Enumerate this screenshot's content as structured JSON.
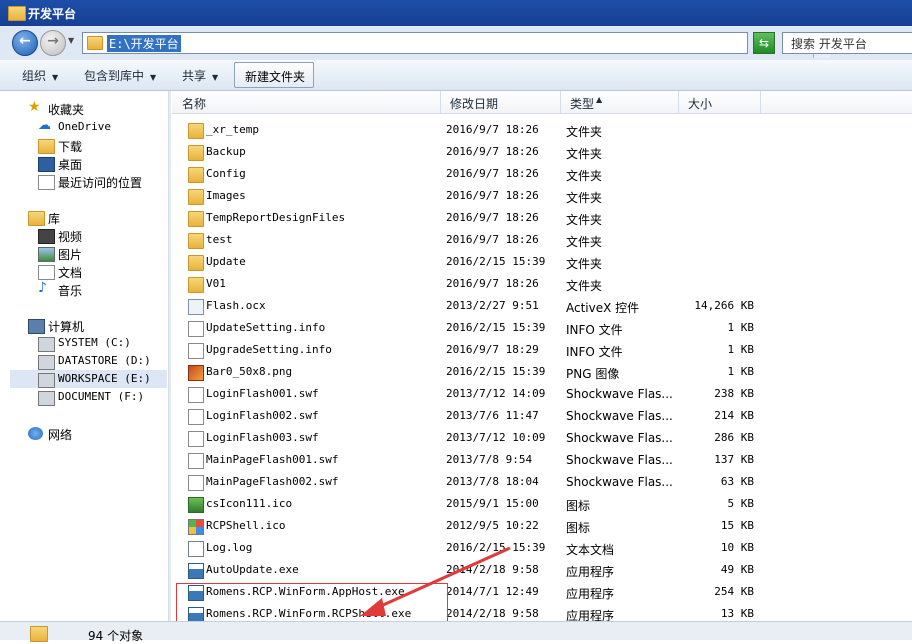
{
  "window": {
    "title": "开发平台"
  },
  "address": {
    "path": "E:\\开发平台",
    "search_placeholder": "搜索 开发平台"
  },
  "toolbar": {
    "organize": "组织",
    "include_in_library": "包含到库中",
    "share": "共享",
    "new_folder": "新建文件夹"
  },
  "nav": {
    "favorites": "收藏夹",
    "onedrive": "OneDrive",
    "downloads": "下载",
    "desktop": "桌面",
    "recent": "最近访问的位置",
    "libraries": "库",
    "videos": "视频",
    "pictures": "图片",
    "documents": "文档",
    "music": "音乐",
    "computer": "计算机",
    "drive_c": "SYSTEM (C:)",
    "drive_d": "DATASTORE (D:)",
    "drive_e": "WORKSPACE (E:)",
    "drive_f": "DOCUMENT (F:)",
    "network": "网络"
  },
  "columns": {
    "name": "名称",
    "modified": "修改日期",
    "type": "类型",
    "size": "大小"
  },
  "files": [
    {
      "name": "_xr_temp",
      "date": "2016/9/7 18:26",
      "type": "文件夹",
      "size": "",
      "icon": "folder-icon"
    },
    {
      "name": "Backup",
      "date": "2016/9/7 18:26",
      "type": "文件夹",
      "size": "",
      "icon": "folder-icon"
    },
    {
      "name": "Config",
      "date": "2016/9/7 18:26",
      "type": "文件夹",
      "size": "",
      "icon": "folder-icon"
    },
    {
      "name": "Images",
      "date": "2016/9/7 18:26",
      "type": "文件夹",
      "size": "",
      "icon": "folder-icon"
    },
    {
      "name": "TempReportDesignFiles",
      "date": "2016/9/7 18:26",
      "type": "文件夹",
      "size": "",
      "icon": "folder-icon"
    },
    {
      "name": "test",
      "date": "2016/9/7 18:26",
      "type": "文件夹",
      "size": "",
      "icon": "folder-icon"
    },
    {
      "name": "Update",
      "date": "2016/2/15 15:39",
      "type": "文件夹",
      "size": "",
      "icon": "folder-icon"
    },
    {
      "name": "V01",
      "date": "2016/9/7 18:26",
      "type": "文件夹",
      "size": "",
      "icon": "folder-icon"
    },
    {
      "name": "Flash.ocx",
      "date": "2013/2/27 9:51",
      "type": "ActiveX 控件",
      "size": "14,266 KB",
      "icon": "ocx-icon"
    },
    {
      "name": "UpdateSetting.info",
      "date": "2016/2/15 15:39",
      "type": "INFO 文件",
      "size": "1 KB",
      "icon": "document-icon"
    },
    {
      "name": "UpgradeSetting.info",
      "date": "2016/9/7 18:29",
      "type": "INFO 文件",
      "size": "1 KB",
      "icon": "document-icon"
    },
    {
      "name": "Bar0_50x8.png",
      "date": "2016/2/15 15:39",
      "type": "PNG 图像",
      "size": "1 KB",
      "icon": "image-icon"
    },
    {
      "name": "LoginFlash001.swf",
      "date": "2013/7/12 14:09",
      "type": "Shockwave Flas...",
      "size": "238 KB",
      "icon": "document-icon"
    },
    {
      "name": "LoginFlash002.swf",
      "date": "2013/7/6 11:47",
      "type": "Shockwave Flas...",
      "size": "214 KB",
      "icon": "document-icon"
    },
    {
      "name": "LoginFlash003.swf",
      "date": "2013/7/12 10:09",
      "type": "Shockwave Flas...",
      "size": "286 KB",
      "icon": "document-icon"
    },
    {
      "name": "MainPageFlash001.swf",
      "date": "2013/7/8 9:54",
      "type": "Shockwave Flas...",
      "size": "137 KB",
      "icon": "document-icon"
    },
    {
      "name": "MainPageFlash002.swf",
      "date": "2013/7/8 18:04",
      "type": "Shockwave Flas...",
      "size": "63 KB",
      "icon": "document-icon"
    },
    {
      "name": "csIcon111.ico",
      "date": "2015/9/1 15:00",
      "type": "图标",
      "size": "5 KB",
      "icon": "icon-file-icon"
    },
    {
      "name": "RCPShell.ico",
      "date": "2012/9/5 10:22",
      "type": "图标",
      "size": "15 KB",
      "icon": "icon-file-icon"
    },
    {
      "name": "Log.log",
      "date": "2016/2/15 15:39",
      "type": "文本文档",
      "size": "10 KB",
      "icon": "log-icon"
    },
    {
      "name": "AutoUpdate.exe",
      "date": "2014/2/18 9:58",
      "type": "应用程序",
      "size": "49 KB",
      "icon": "exe-icon"
    },
    {
      "name": "Romens.RCP.WinForm.AppHost.exe",
      "date": "2014/7/1 12:49",
      "type": "应用程序",
      "size": "254 KB",
      "icon": "exe-icon"
    },
    {
      "name": "Romens.RCP.WinForm.RCPShell.exe",
      "date": "2014/2/18 9:58",
      "type": "应用程序",
      "size": "13 KB",
      "icon": "exe-icon"
    }
  ],
  "status": {
    "count": "94 个对象"
  },
  "colors": {
    "title_bar": "#1d4ea8",
    "address_highlight": "#3173c2",
    "annotation": "#e03a3a"
  }
}
